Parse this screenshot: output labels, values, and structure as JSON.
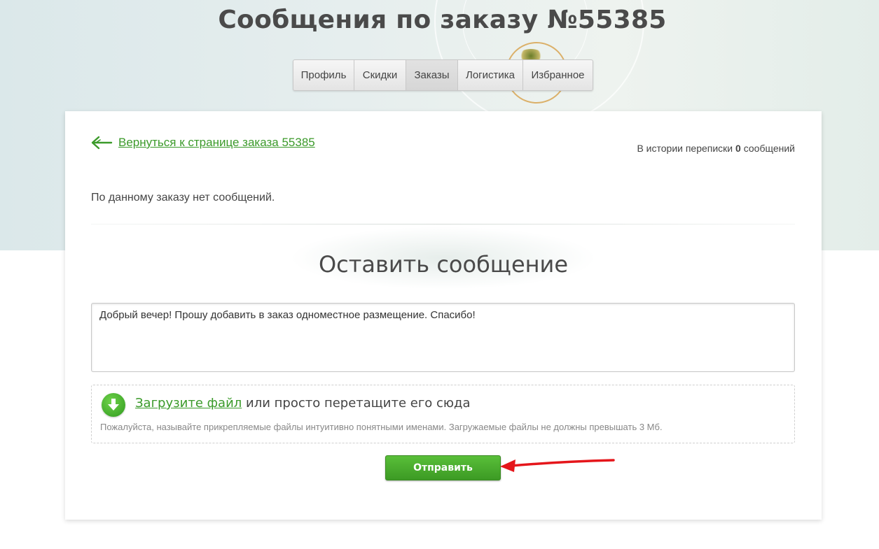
{
  "header": {
    "title": "Сообщения по заказу №55385"
  },
  "tabs": [
    {
      "label": "Профиль",
      "active": false
    },
    {
      "label": "Скидки",
      "active": false
    },
    {
      "label": "Заказы",
      "active": true
    },
    {
      "label": "Логистика",
      "active": false
    },
    {
      "label": "Избранное",
      "active": false
    }
  ],
  "card": {
    "back_link": "Вернуться к странице заказа 55385",
    "history_prefix": "В истории переписки",
    "history_count": "0",
    "history_suffix": "сообщений",
    "no_messages": "По данному заказу нет сообщений.",
    "section_title": "Оставить сообщение",
    "message_value": "Добрый вечер! Прошу добавить в заказ одноместное размещение. Спасибо!",
    "upload": {
      "link_text": "Загрузите файл",
      "rest_text": " или просто перетащите его сюда",
      "hint": "Пожалуйста, называйте прикрепляемые файлы интуитивно понятными именами. Загружаемые файлы не должны превышать 3 Мб."
    },
    "send_label": "Отправить"
  },
  "colors": {
    "accent_green": "#3b9a2a",
    "button_green": "#4aad2e",
    "annotation_red": "#e5161b"
  }
}
